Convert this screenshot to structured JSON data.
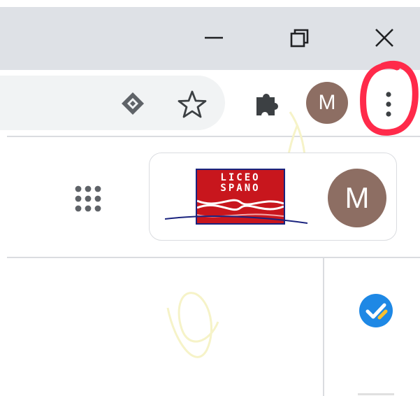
{
  "window": {
    "controls": {
      "minimize_icon": "minimize-icon",
      "restore_icon": "restore-icon",
      "close_icon": "close-icon"
    }
  },
  "toolbar": {
    "omnibox_icons": [
      "lens-icon",
      "star-icon"
    ],
    "extensions_icon": "puzzle-icon",
    "profile_initial": "M",
    "menu_icon": "three-dots-vertical-icon"
  },
  "page_header": {
    "apps_icon": "apps-grid-icon",
    "org_logo": {
      "line1": "LICEO",
      "line2": "SPANO"
    },
    "account_initial": "M"
  },
  "side_panel": {
    "app_icon": "tasks-icon"
  },
  "colors": {
    "titlebar": "#dee1e6",
    "omnibox": "#f1f3f4",
    "avatar": "#8d6e63",
    "annotation": "#ff2a4a",
    "logo_red": "#c8161d",
    "logo_blue": "#1a237e",
    "tasks_blue": "#1e88e5",
    "tasks_yellow": "#fbc02d"
  }
}
